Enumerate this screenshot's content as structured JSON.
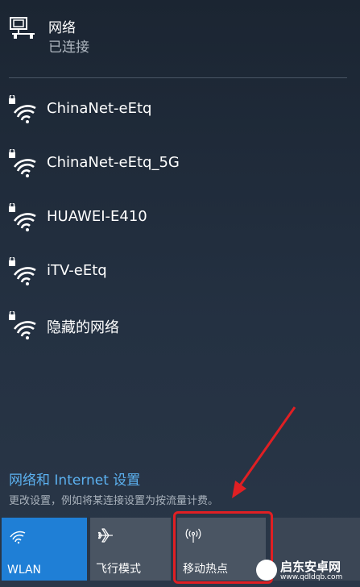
{
  "header": {
    "title": "网络",
    "status": "已连接",
    "icon": "wired-network-icon"
  },
  "networks": [
    {
      "ssid": "ChinaNet-eEtq",
      "icon": "secured-wifi-icon"
    },
    {
      "ssid": "ChinaNet-eEtq_5G",
      "icon": "secured-wifi-icon"
    },
    {
      "ssid": "HUAWEI-E410",
      "icon": "secured-wifi-icon"
    },
    {
      "ssid": "iTV-eEtq",
      "icon": "secured-wifi-icon"
    },
    {
      "ssid": "隐藏的网络",
      "icon": "secured-wifi-icon"
    }
  ],
  "settings": {
    "title": "网络和 Internet 设置",
    "description": "更改设置，例如将某连接设置为按流量计费。"
  },
  "quick_actions": [
    {
      "label": "WLAN",
      "icon": "wifi-icon",
      "active": true
    },
    {
      "label": "飞行模式",
      "icon": "airplane-icon",
      "active": false
    },
    {
      "label": "移动热点",
      "icon": "hotspot-icon",
      "active": false
    }
  ],
  "watermark": {
    "text": "启东安卓网",
    "url": "www.qdldqb.com"
  },
  "colors": {
    "accent": "#1f7fd6",
    "link": "#5cb1f0",
    "annotation": "#e01f23"
  }
}
